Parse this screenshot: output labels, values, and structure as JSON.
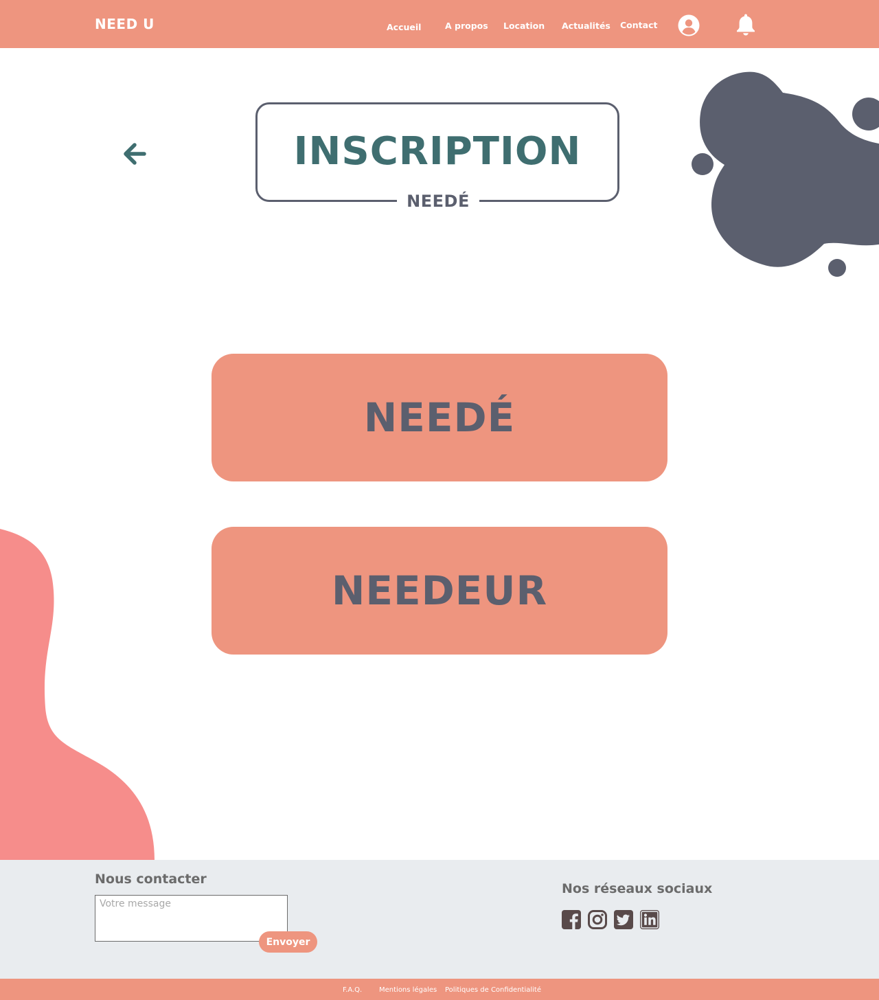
{
  "header": {
    "logo": "NEED U",
    "nav": {
      "accueil": "Accueil",
      "apropos": "A propos",
      "location": "Location",
      "actualites": "Actualités",
      "contact": "Contact"
    },
    "icons": [
      "user-circle-icon",
      "bell-icon"
    ]
  },
  "main": {
    "title": "INSCRIPTION",
    "subtitle": "NEEDÉ",
    "choices": {
      "neede": "NEEDÉ",
      "needeur": "NEEDEUR"
    }
  },
  "footer": {
    "contact_title": "Nous contacter",
    "message_placeholder": "Votre message",
    "send_label": "Envoyer",
    "social_title": "Nos réseaux sociaux",
    "social_icons": [
      "facebook-icon",
      "instagram-icon",
      "twitter-icon",
      "linkedin-icon"
    ],
    "links": {
      "faq": "F.A.Q.",
      "mentions": "Mentions légales",
      "privacy": "Politiques de Confidentialité"
    }
  },
  "colors": {
    "accent": "#ee957f",
    "dark": "#5b5f6e",
    "teal": "#3f6e70",
    "blob_pink": "#f68d8b",
    "footer_bg": "#e9ecef"
  }
}
